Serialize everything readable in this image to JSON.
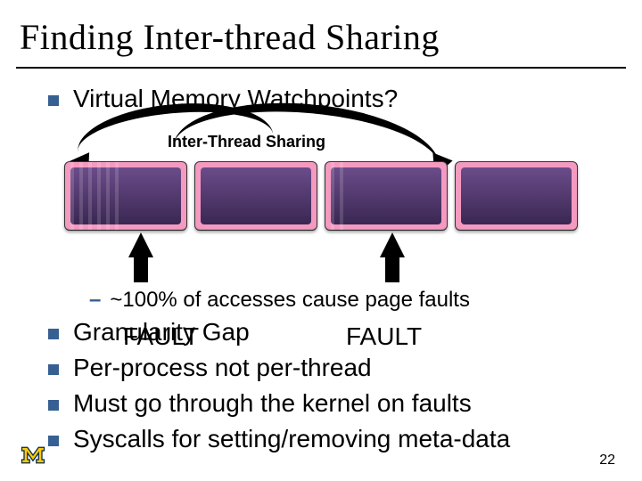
{
  "title": "Finding Inter-thread Sharing",
  "bullets": [
    "Virtual Memory Watchpoints?"
  ],
  "diagram": {
    "label": "Inter-Thread Sharing",
    "fault1": "FAULT",
    "fault2": "FAULT"
  },
  "sub_bullet": "~100% of accesses cause page faults",
  "bullets2": [
    "Granularity Gap",
    "Per-process not per-thread",
    "Must go through the kernel on faults",
    "Syscalls for setting/removing meta-data"
  ],
  "slide_number": "22"
}
